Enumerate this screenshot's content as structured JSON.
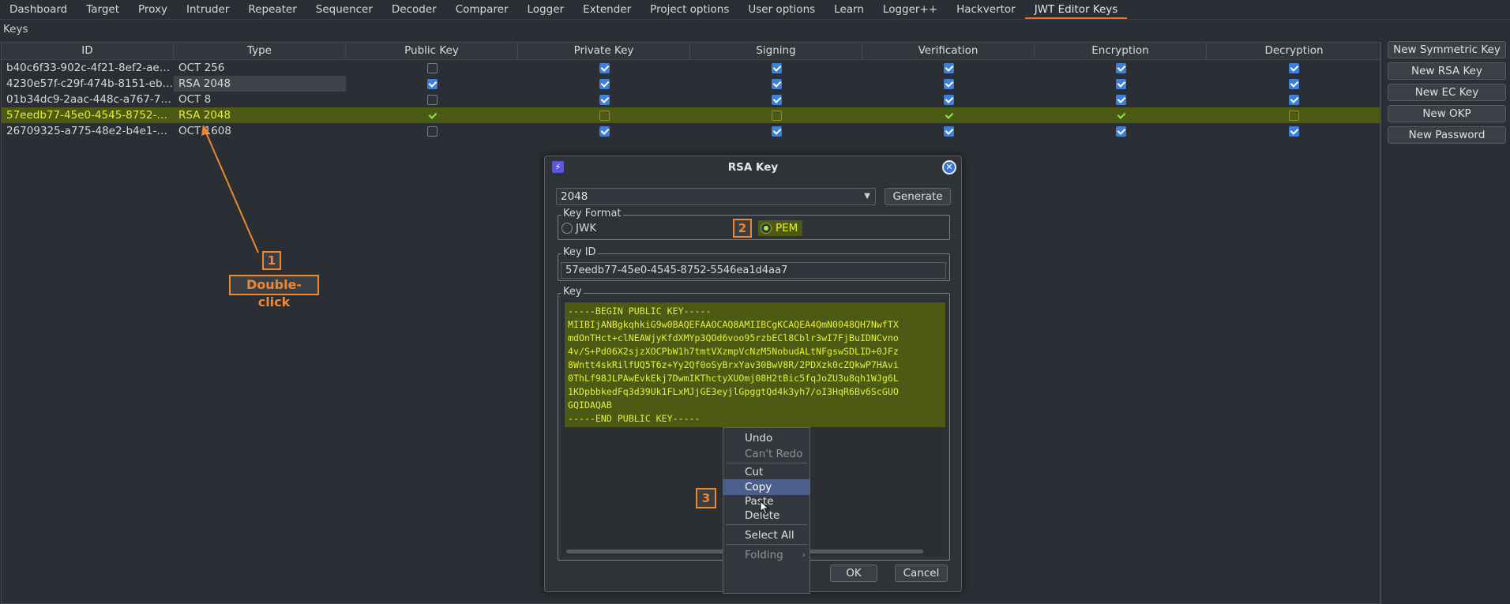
{
  "tabs": [
    {
      "label": "Dashboard"
    },
    {
      "label": "Target"
    },
    {
      "label": "Proxy"
    },
    {
      "label": "Intruder"
    },
    {
      "label": "Repeater"
    },
    {
      "label": "Sequencer"
    },
    {
      "label": "Decoder"
    },
    {
      "label": "Comparer"
    },
    {
      "label": "Logger"
    },
    {
      "label": "Extender"
    },
    {
      "label": "Project options"
    },
    {
      "label": "User options"
    },
    {
      "label": "Learn"
    },
    {
      "label": "Logger++"
    },
    {
      "label": "Hackvertor"
    },
    {
      "label": "JWT Editor Keys",
      "active": true
    }
  ],
  "section_label": "Keys",
  "table": {
    "columns": [
      "ID",
      "Type",
      "Public Key",
      "Private Key",
      "Signing",
      "Verification",
      "Encryption",
      "Decryption"
    ],
    "rows": [
      {
        "id": "b40c6f33-902c-4f21-8ef2-ae4b4e...",
        "type": "OCT 256",
        "checks": [
          false,
          true,
          true,
          true,
          true,
          true
        ]
      },
      {
        "id": "4230e57f-c29f-474b-8151-eb106...",
        "type": "RSA 2048",
        "checks": [
          true,
          true,
          true,
          true,
          true,
          true
        ]
      },
      {
        "id": "01b34dc9-2aac-448c-a767-78f42...",
        "type": "OCT 8",
        "checks": [
          false,
          true,
          true,
          true,
          true,
          true
        ]
      },
      {
        "id": "57eedb77-45e0-4545-8752-5546...",
        "type": "RSA 2048",
        "checks": [
          true,
          false,
          false,
          true,
          true,
          false
        ],
        "selected": true
      },
      {
        "id": "26709325-a775-48e2-b4e1-68e4...",
        "type": "OCT 1608",
        "checks": [
          false,
          true,
          true,
          true,
          true,
          true
        ]
      }
    ]
  },
  "side_buttons": [
    "New Symmetric Key",
    "New RSA Key",
    "New EC Key",
    "New OKP",
    "New Password"
  ],
  "annotations": {
    "step1": "1",
    "step1_label": "Double-click",
    "step2": "2",
    "step3": "3"
  },
  "dialog": {
    "title": "RSA Key",
    "logo_icon": "burp-lightning-icon",
    "close_icon": "close-icon",
    "key_size": "2048",
    "generate_label": "Generate",
    "key_format_legend": "Key Format",
    "format_jwk": "JWK",
    "format_pem": "PEM",
    "key_id_legend": "Key ID",
    "key_id_value": "57eedb77-45e0-4545-8752-5546ea1d4aa7",
    "key_legend": "Key",
    "key_lines": [
      "-----BEGIN PUBLIC KEY-----",
      "MIIBIjANBgkqhkiG9w0BAQEFAAOCAQ8AMIIBCgKCAQEA4QmN0048QH7NwfTX",
      "mdOnTHct+clNEAWjyKfdXMYp3QOd6voo95rzbECl8Cblr3wI7FjBuIDNCvno",
      "4v/S+Pd06X2sjzXOCPbW1h7tmtVXzmpVcNzM5NobudALtNFgswSDLID+0JFz",
      "8Wntt4skRilfUQ5T6z+Yy2Qf0oSyBrxYav30BwV8R/2PDXzk0cZQkwP7HAvi",
      "0ThLf98JLPAwEvkEkj7DwmIKThctyXUOmj08H2tBic5fqJoZU3u8qh1WJg6L",
      "1KDpbbkedFq3d39Uk1FLxMJjGE3eyjlGpggtQd4k3yh7/oI3HqR6Bv6ScGUO",
      "GQIDAQAB",
      "-----END PUBLIC KEY-----"
    ],
    "ok_label": "OK",
    "cancel_label": "Cancel"
  },
  "context_menu": {
    "items": [
      {
        "label": "Undo"
      },
      {
        "label": "Can't Redo",
        "disabled": true
      },
      {
        "label": "Cut"
      },
      {
        "label": "Copy",
        "active": true
      },
      {
        "label": "Paste"
      },
      {
        "label": "Delete"
      },
      {
        "label": "Select All"
      },
      {
        "label": "Folding",
        "disabled": true,
        "submenu": true
      }
    ]
  },
  "colors": {
    "accent_orange": "#f0872f",
    "selection_row": "#4d5a14",
    "selection_text": "#e7ec32",
    "checkbox_blue": "#3d7fd9",
    "menu_highlight": "#4c5e8c"
  }
}
